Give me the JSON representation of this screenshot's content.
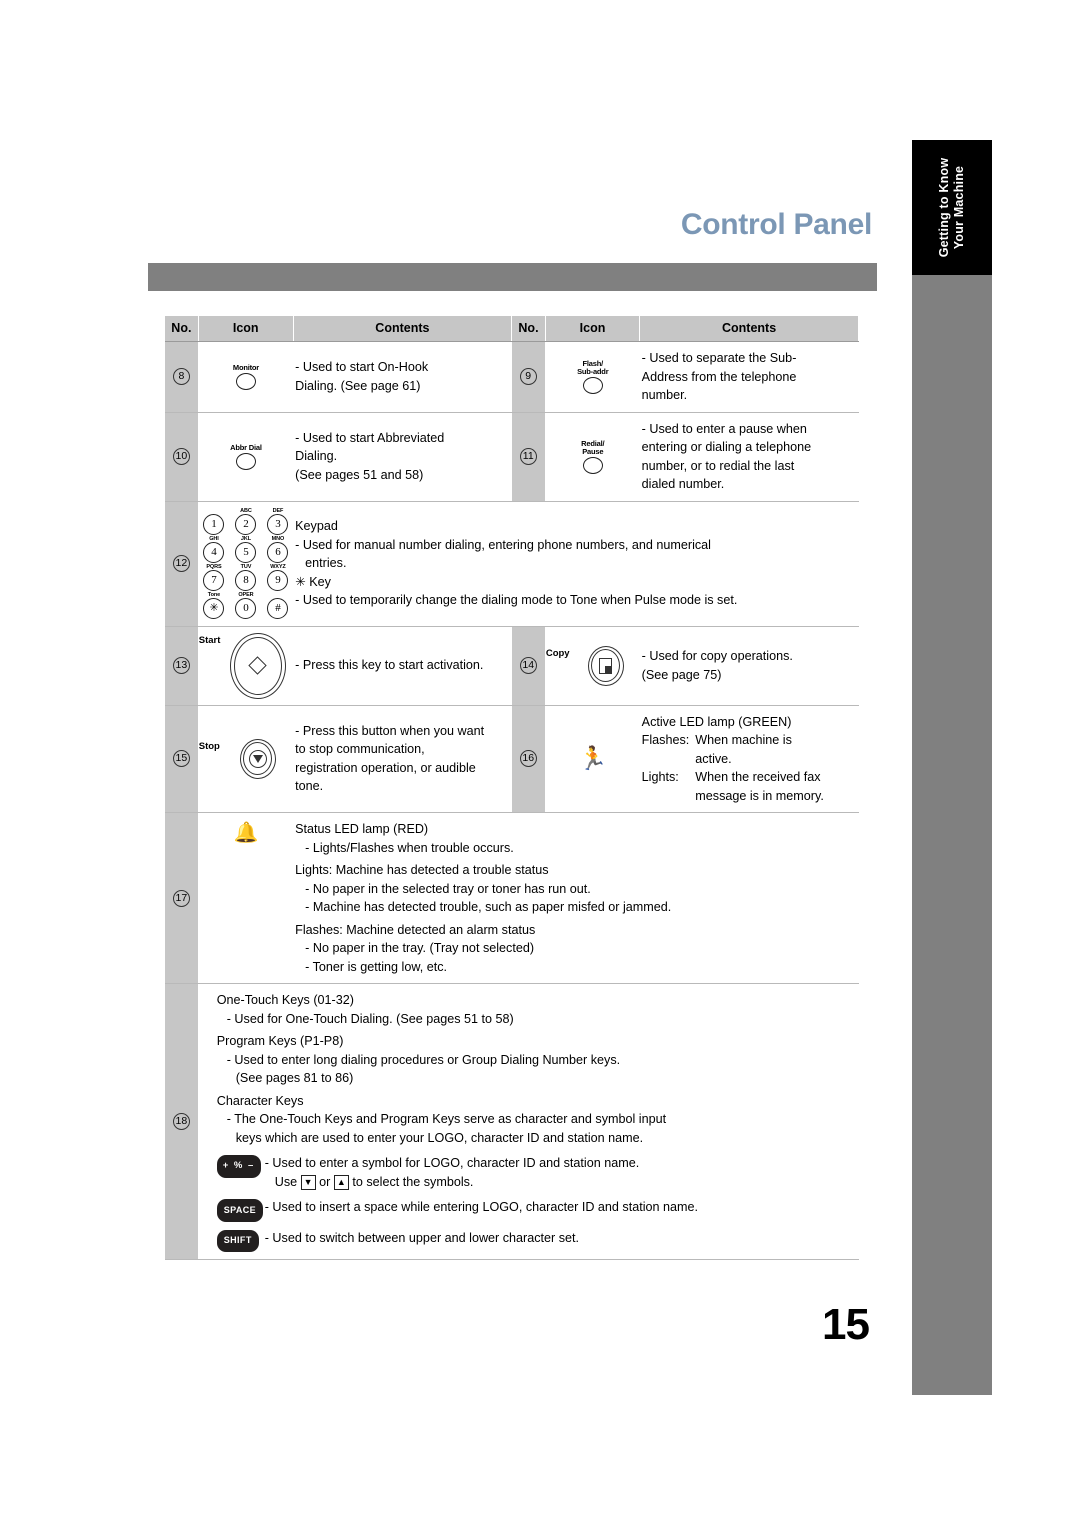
{
  "side_tab": {
    "label": "Getting to Know\nYour Machine"
  },
  "header": {
    "title": "Control Panel"
  },
  "table": {
    "columns": [
      "No.",
      "Icon",
      "Contents",
      "No.",
      "Icon",
      "Contents"
    ],
    "rows": [
      {
        "left": {
          "no": "8",
          "icon_label": "Monitor",
          "contents": "-  Used to start On-Hook\n   Dialing. (See page 61)"
        },
        "right": {
          "no": "9",
          "icon_label": "Flash/\nSub-addr",
          "contents": "-  Used to separate the Sub-\n   Address from the telephone\n   number."
        }
      },
      {
        "left": {
          "no": "10",
          "icon_label": "Abbr Dial",
          "contents": "-  Used to start Abbreviated\n   Dialing.\n   (See pages 51 and 58)"
        },
        "right": {
          "no": "11",
          "icon_label": "Redial/\nPause",
          "contents": "-  Used to enter a pause when\n   entering or dialing a telephone\n   number, or to redial the last\n   dialed number."
        }
      }
    ],
    "keypad_row": {
      "no": "12",
      "keys": [
        {
          "sub": "",
          "key": "1"
        },
        {
          "sub": "ABC",
          "key": "2"
        },
        {
          "sub": "DEF",
          "key": "3"
        },
        {
          "sub": "GHI",
          "key": "4"
        },
        {
          "sub": "JKL",
          "key": "5"
        },
        {
          "sub": "MNO",
          "key": "6"
        },
        {
          "sub": "PQRS",
          "key": "7"
        },
        {
          "sub": "TUV",
          "key": "8"
        },
        {
          "sub": "WXYZ",
          "key": "9"
        },
        {
          "sub": "Tone",
          "key": "✳"
        },
        {
          "sub": "OPER",
          "key": "0"
        },
        {
          "sub": "",
          "key": "#"
        }
      ],
      "heading1": "Keypad",
      "line1": "-  Used for manual number dialing, entering phone numbers, and numerical",
      "line1b": "entries.",
      "heading2": "✳ Key",
      "line2": "-  Used to temporarily change the dialing mode to Tone when Pulse mode is set."
    },
    "start_row": {
      "left": {
        "no": "13",
        "icon_label": "Start",
        "contents": "-  Press this key to start activation."
      },
      "right": {
        "no": "14",
        "icon_label": "Copy",
        "contents": "-  Used for copy operations.\n   (See page 75)"
      }
    },
    "stop_row": {
      "left": {
        "no": "15",
        "icon_label": "Stop",
        "contents": "-  Press this button when you want\n   to stop communication,\n   registration operation, or audible\n   tone."
      },
      "right": {
        "no": "16",
        "icon_name": "running-person-icon",
        "heading": "Active LED lamp (GREEN)",
        "rows": [
          {
            "key": "Flashes:",
            "val": "When machine is"
          },
          {
            "key": "",
            "val": "      active."
          },
          {
            "key": "Lights:",
            "val": "When the received fax"
          },
          {
            "key": "",
            "val": "message is in memory."
          }
        ]
      }
    },
    "status_row": {
      "no": "17",
      "icon_name": "bell-icon",
      "heading": "Status LED lamp (RED)",
      "line1": "-  Lights/Flashes when trouble occurs.",
      "group1_head": "Lights: Machine has detected a trouble status",
      "group1_items": [
        "-  No paper in the selected tray or toner has run out.",
        "-  Machine has detected trouble, such as paper misfed or jammed."
      ],
      "group2_head": "Flashes: Machine detected an alarm status",
      "group2_items": [
        "-  No paper in the tray. (Tray not selected)",
        "-  Toner is getting low, etc."
      ]
    },
    "keys_row": {
      "no": "18",
      "block1_head": "One-Touch Keys (01-32)",
      "block1_item": "-  Used for One-Touch Dialing. (See pages 51 to 58)",
      "block2_head": "Program Keys (P1-P8)",
      "block2_item": "-  Used to enter long dialing procedures or Group Dialing Number keys.",
      "block2_item_cont": "(See pages 81 to 86)",
      "block3_head": "Character Keys",
      "block3_item": "-  The One-Touch Keys and Program Keys serve as character and symbol input",
      "block3_item_cont": "keys which are used to enter your LOGO, character ID and station name.",
      "key_items": [
        {
          "pill": "+ % –",
          "pill_type": "symbol",
          "text": "-  Used to enter a symbol for LOGO, character ID and station name.",
          "text2_pre": "Use",
          "text2_mid": "or",
          "text2_post": "to select the symbols.",
          "down_arrow": "▼",
          "up_arrow": "▲"
        },
        {
          "pill": "SPACE",
          "pill_type": "word",
          "text": "-  Used to insert a space while entering LOGO, character ID and station name."
        },
        {
          "pill": "SHIFT",
          "pill_type": "word",
          "text": "-  Used to switch between upper and lower character set."
        }
      ]
    }
  },
  "footer": {
    "page_number": "15"
  },
  "colors": {
    "title_blue": "#7b97b5",
    "header_gray": "#808080",
    "table_header_gray": "#c6c6c6",
    "tab_black": "#000000"
  }
}
